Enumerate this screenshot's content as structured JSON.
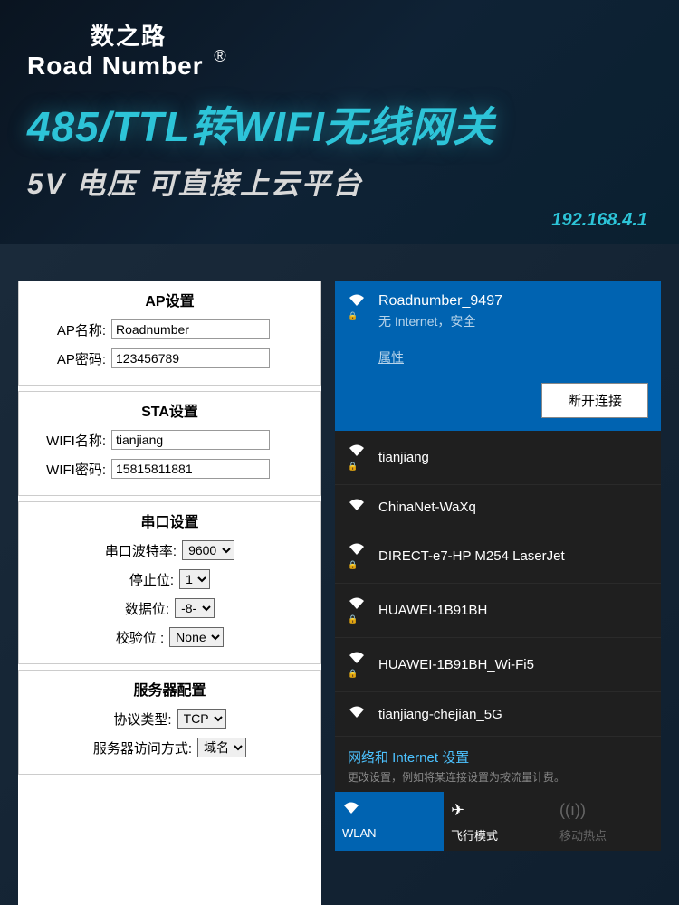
{
  "header": {
    "logo_cn": "数之路",
    "logo_en": "Road Number",
    "reg": "®",
    "title1": "485/TTL转WIFI无线网关",
    "title2": "5V 电压 可直接上云平台",
    "ip": "192.168.4.1"
  },
  "config": {
    "ap": {
      "title": "AP设置",
      "name_label": "AP名称:",
      "name_value": "Roadnumber",
      "pwd_label": "AP密码:",
      "pwd_value": "123456789"
    },
    "sta": {
      "title": "STA设置",
      "name_label": "WIFI名称:",
      "name_value": "tianjiang",
      "pwd_label": "WIFI密码:",
      "pwd_value": "15815811881"
    },
    "serial": {
      "title": "串口设置",
      "baud_label": "串口波特率:",
      "baud_value": "9600",
      "stop_label": "停止位:",
      "stop_value": "1",
      "data_label": "数据位:",
      "data_value": "-8-",
      "parity_label": "校验位 :",
      "parity_value": "None"
    },
    "server": {
      "title": "服务器配置",
      "proto_label": "协议类型:",
      "proto_value": "TCP",
      "access_label": "服务器访问方式:",
      "access_value": "域名"
    }
  },
  "wifi": {
    "connected": {
      "name": "Roadnumber_9497",
      "status": "无 Internet，安全",
      "properties": "属性",
      "disconnect": "断开连接"
    },
    "networks": [
      "tianjiang",
      "ChinaNet-WaXq",
      "DIRECT-e7-HP M254 LaserJet",
      "HUAWEI-1B91BH",
      "HUAWEI-1B91BH_Wi-Fi5",
      "tianjiang-chejian_5G"
    ],
    "settings": {
      "link": "网络和 Internet 设置",
      "desc": "更改设置，例如将某连接设置为按流量计费。"
    },
    "tabs": {
      "wlan": "WLAN",
      "airplane": "飞行模式",
      "hotspot": "移动热点"
    }
  }
}
